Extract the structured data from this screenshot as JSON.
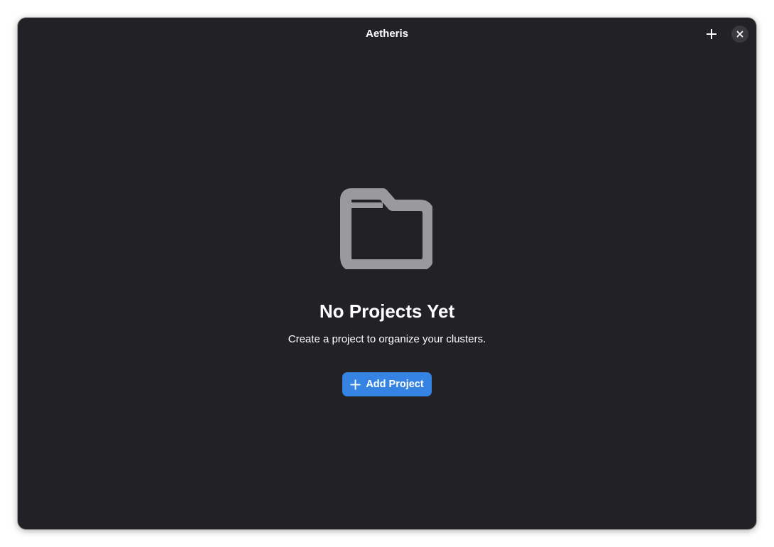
{
  "window": {
    "title": "Aetheris"
  },
  "header": {
    "add_icon": "plus-icon",
    "close_icon": "close-icon"
  },
  "empty_state": {
    "icon": "folder-icon",
    "title": "No Projects Yet",
    "description": "Create a project to organize your clusters.",
    "button_label": "Add Project",
    "button_icon": "plus-icon"
  },
  "colors": {
    "window_bg": "#222226",
    "accent": "#3584e4",
    "icon_gray": "#9a9a9c",
    "text": "#ffffff"
  }
}
